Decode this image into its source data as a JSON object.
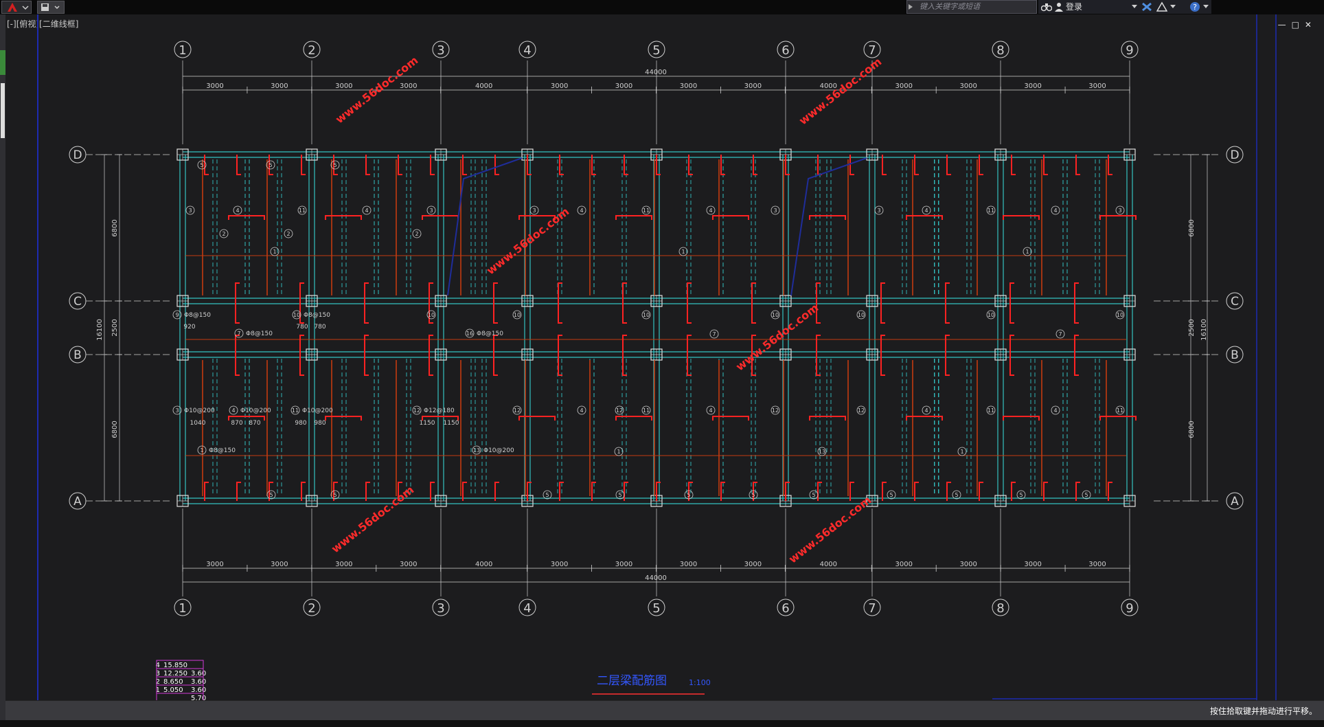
{
  "app": {
    "view_label": "[-][俯视][二维线框]",
    "search_placeholder": "键入关键字或短语",
    "login_label": "登录",
    "status_hint": "按住拾取键并拖动进行平移。"
  },
  "drawing": {
    "title": "二层梁配筋图",
    "scale": "1:100",
    "total_length": "44000",
    "top_spans": [
      "3000",
      "3000",
      "3000",
      "3000",
      "4000",
      "3000",
      "3000",
      "3000",
      "3000",
      "4000",
      "3000",
      "3000",
      "3000",
      "3000"
    ],
    "bottom_spans": [
      "3000",
      "3000",
      "3000",
      "3000",
      "4000",
      "3000",
      "3000",
      "3000",
      "3000",
      "4000",
      "3000",
      "3000",
      "3000",
      "3000"
    ],
    "axes_x": [
      "1",
      "2",
      "3",
      "4",
      "5",
      "6",
      "7",
      "8",
      "9"
    ],
    "axes_y": [
      "D",
      "C",
      "B",
      "A"
    ],
    "left_dims": [
      "6800",
      "2500",
      "6800"
    ],
    "total_depth": "16100",
    "right_dims": [
      "6800",
      "2500",
      "6800"
    ],
    "watermark": "www.56doc.com",
    "rebar_labels": [
      {
        "id": "9",
        "text": "Φ8@150"
      },
      {
        "id": "10",
        "text": "Φ8@150"
      },
      {
        "id": "7",
        "text": "Φ8@150"
      },
      {
        "id": "16",
        "text": "Φ8@150"
      },
      {
        "id": "3",
        "text": "Φ10@200"
      },
      {
        "id": "4",
        "text": "Φ10@200"
      },
      {
        "id": "11",
        "text": "Φ10@200"
      },
      {
        "id": "12",
        "text": "Φ12@180"
      },
      {
        "id": "1",
        "text": "Φ8@150"
      },
      {
        "id": "13",
        "text": "Φ10@200"
      }
    ],
    "rebar_lengths": [
      "920",
      "780",
      "780",
      "1040",
      "870",
      "870",
      "980",
      "980",
      "1150",
      "1150"
    ],
    "floor_table": [
      {
        "floor": "4",
        "elev": "15.850",
        "height": ""
      },
      {
        "floor": "3",
        "elev": "12.250",
        "height": "3.60"
      },
      {
        "floor": "2",
        "elev": "8.650",
        "height": "3.60"
      },
      {
        "floor": "1",
        "elev": "5.050",
        "height": "3.60"
      },
      {
        "floor": "",
        "elev": "",
        "height": "5.70"
      }
    ],
    "colors": {
      "axis": "#d0d0d0",
      "beam": "#33c2c2",
      "rebar": "#ff2222",
      "bar": "#c43a10",
      "watermark": "#ff2b2b",
      "slab": "#1f2d9a",
      "title": "#3357ff",
      "table": "#d23ad8"
    }
  }
}
